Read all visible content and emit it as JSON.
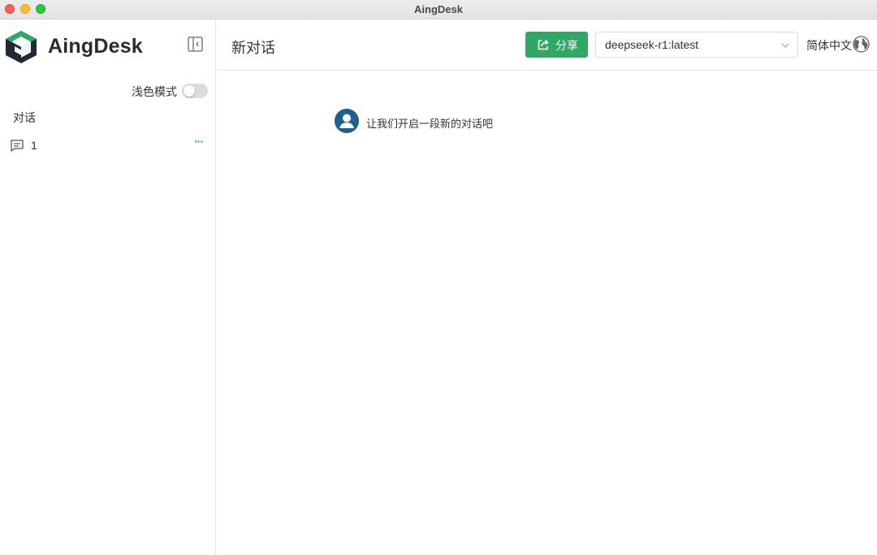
{
  "window": {
    "title": "AingDesk"
  },
  "sidebar": {
    "brand": "AingDesk",
    "theme_label": "浅色模式",
    "theme_toggle_on": false,
    "section_label": "对话",
    "conversations": [
      {
        "name": "1",
        "more": "···"
      }
    ]
  },
  "header": {
    "title": "新对话",
    "share_label": "分享",
    "model_value": "deepseek-r1:latest",
    "language_label": "简体中文"
  },
  "chat": {
    "welcome_text": "让我们开启一段新的对话吧"
  },
  "colors": {
    "accent": "#2fa866",
    "avatar": "#1e5f8c",
    "logo_dark": "#1f2a35"
  },
  "icons": [
    "app-logo-icon",
    "sidebar-collapse-icon",
    "chat-bubble-icon",
    "share-icon",
    "chevron-down-icon",
    "globe-icon",
    "user-avatar-icon"
  ]
}
